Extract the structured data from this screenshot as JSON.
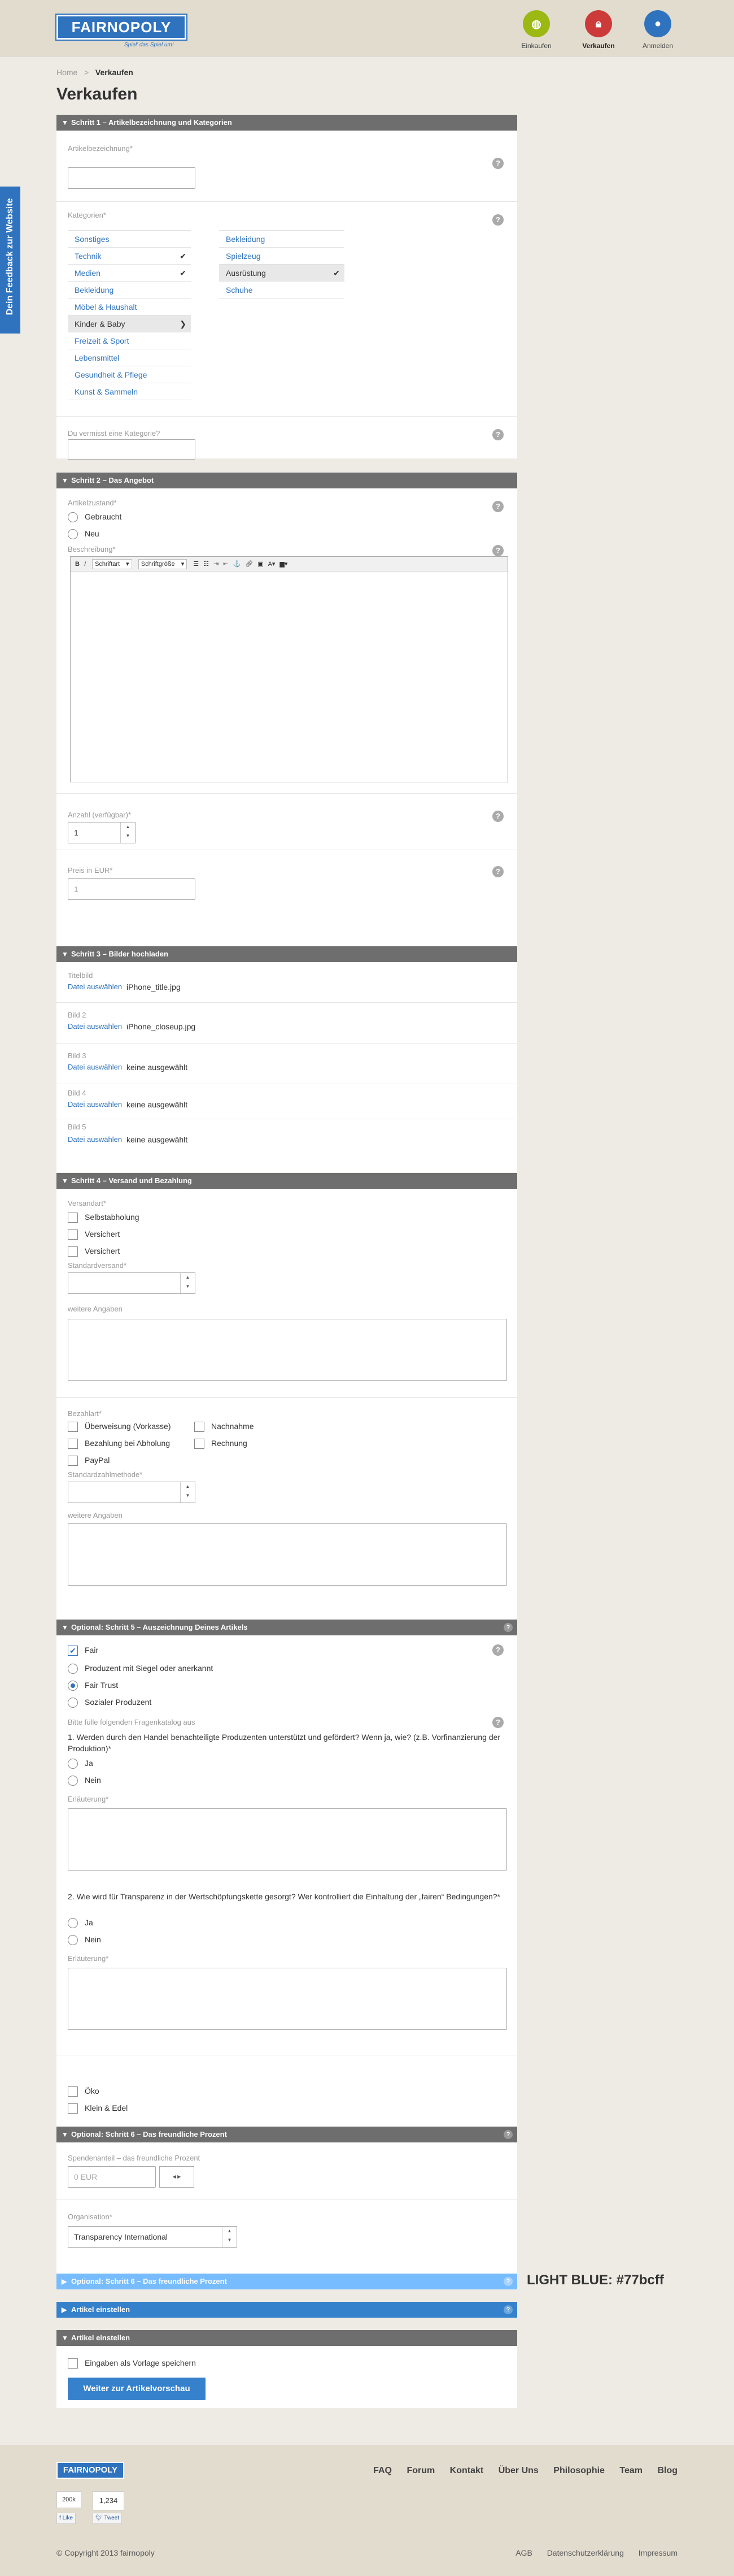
{
  "header": {
    "logo": "FAIRNOPOLY",
    "tagline": "Spiel' das Spiel um!",
    "nav": [
      {
        "label": "Einkaufen",
        "color": "#9cb812"
      },
      {
        "label": "Verkaufen",
        "color": "#cc3a3a"
      },
      {
        "label": "Anmelden",
        "color": "#2f73be"
      }
    ]
  },
  "breadcrumb": {
    "home": "Home",
    "sep": ">",
    "current": "Verkaufen"
  },
  "page_title": "Verkaufen",
  "feedback": "Dein Feedback zur Website",
  "s1": {
    "title": "Schritt 1 – Artikelbezeichnung und Kategorien",
    "name_label": "Artikelbezeichnung*",
    "cat_label": "Kategorien*",
    "cats_left": [
      "Sonstiges",
      "Technik",
      "Medien",
      "Bekleidung",
      "Möbel & Haushalt",
      "Kinder & Baby",
      "Freizeit & Sport",
      "Lebensmittel",
      "Gesundheit & Pflege",
      "Kunst & Sammeln"
    ],
    "cats_right": [
      "Bekleidung",
      "Spielzeug",
      "Ausrüstung",
      "Schuhe"
    ],
    "missing_label": "Du vermisst eine Kategorie?"
  },
  "s2": {
    "title": "Schritt 2 – Das Angebot",
    "cond_label": "Artikelzustand*",
    "cond_opts": [
      "Gebraucht",
      "Neu"
    ],
    "desc_label": "Beschreibung*",
    "toolbar": {
      "font": "Schriftart",
      "size": "Schriftgröße"
    },
    "qty_label": "Anzahl (verfügbar)*",
    "qty_value": "1",
    "price_label": "Preis in EUR*",
    "price_value": "1"
  },
  "s3": {
    "title": "Schritt 3 – Bilder hochladen",
    "choose": "Datei auswählen",
    "images": [
      {
        "label": "Titelbild",
        "file": "iPhone_title.jpg"
      },
      {
        "label": "Bild 2",
        "file": "iPhone_closeup.jpg"
      },
      {
        "label": "Bild 3",
        "file": "keine ausgewählt"
      },
      {
        "label": "Bild 4",
        "file": "keine ausgewählt"
      },
      {
        "label": "Bild 5",
        "file": "keine ausgewählt"
      }
    ]
  },
  "s4": {
    "title": "Schritt 4 – Versand und Bezahlung",
    "ship_label": "Versandart*",
    "ship_opts": [
      "Selbstabholung",
      "Versichert",
      "Versichert"
    ],
    "std_ship_label": "Standardversand*",
    "more_label": "weitere Angaben",
    "pay_label": "Bezahlart*",
    "pay_left": [
      "Überweisung (Vorkasse)",
      "Bezahlung bei Abholung",
      "PayPal"
    ],
    "pay_right": [
      "Nachnahme",
      "Rechnung"
    ],
    "std_pay_label": "Standardzahlmethode*",
    "more_label2": "weitere Angaben"
  },
  "s5": {
    "title": "Optional: Schritt 5 – Auszeichnung Deines Artikels",
    "fair": "Fair",
    "fair_opts": [
      "Produzent mit Siegel oder anerkannt",
      "Fair Trust",
      "Sozialer Produzent"
    ],
    "questions_label": "Bitte fülle folgenden Fragenkatalog aus",
    "q1": "1. Werden durch den Handel benachteiligte Produzenten unterstützt und gefördert? Wenn ja, wie? (z.B. Vorfinanzierung der Produktion)*",
    "yes": "Ja",
    "no": "Nein",
    "explain": "Erläuterung*",
    "q2": "2. Wie wird für Transparenz in der Wertschöpfungskette gesorgt? Wer kontrolliert die Einhaltung der „fairen“ Bedingungen?*",
    "eco": "Öko",
    "small": "Klein & Edel"
  },
  "s6": {
    "title": "Optional: Schritt 6 – Das freundliche Prozent",
    "donation_label": "Spendenanteil – das freundliche Prozent",
    "donation_ph": "0 EUR",
    "org_label": "Organisation*",
    "org_value": "Transparency International"
  },
  "s6b": {
    "title": "Optional: Schritt 6 – Das freundliche Prozent"
  },
  "s7": {
    "title": "Artikel einstellen"
  },
  "s8": {
    "title": "Artikel einstellen",
    "save_tpl": "Eingaben als Vorlage speichern",
    "submit": "Weiter zur Artikelvorschau"
  },
  "note": "LIGHT BLUE: #77bcff",
  "footer": {
    "logo": "FAIRNOPOLY",
    "links": [
      "FAQ",
      "Forum",
      "Kontakt",
      "Über Uns",
      "Philosophie",
      "Team",
      "Blog"
    ],
    "count1": "200k",
    "count2": "1,234",
    "like": "Like",
    "tweet": "Tweet",
    "copyright": "© Copyright 2013 fairnopoly",
    "legal": [
      "AGB",
      "Datenschutzerklärung",
      "Impressum"
    ]
  }
}
